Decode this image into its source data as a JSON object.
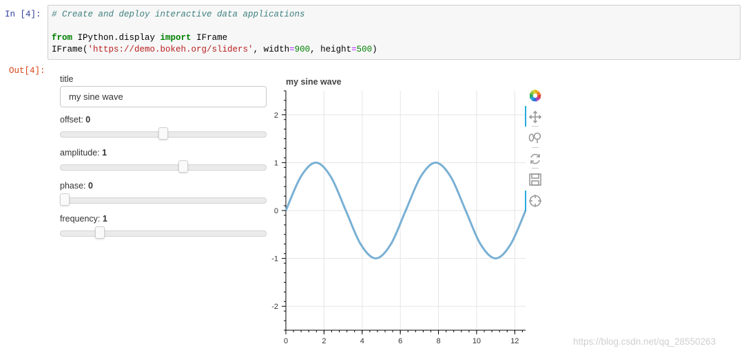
{
  "notebook": {
    "in_prompt": "In  [4]:",
    "out_prompt": "Out[4]:",
    "code": {
      "comment": "# Create and deploy interactive data applications",
      "kw_from": "from",
      "module": " IPython.display ",
      "kw_import": "import",
      "imported": " IFrame",
      "call_name": "IFrame(",
      "url_str": "'https://demo.bokeh.org/sliders'",
      "comma_width": ", width",
      "eq1": "=",
      "width_val": "900",
      "comma_height": ", height",
      "eq2": "=",
      "height_val": "500",
      "close_paren": ")"
    }
  },
  "widgets": {
    "title_label": "title",
    "title_value": "my sine wave",
    "sliders": [
      {
        "label": "offset: ",
        "value": "0",
        "min": -5,
        "max": 5,
        "current": 0
      },
      {
        "label": "amplitude: ",
        "value": "1",
        "min": -5,
        "max": 5,
        "current": 1
      },
      {
        "label": "phase: ",
        "value": "0",
        "min": 0,
        "max": 6.2832,
        "current": 0
      },
      {
        "label": "frequency: ",
        "value": "1",
        "min": 0.1,
        "max": 5.1,
        "current": 1
      }
    ]
  },
  "chart_data": {
    "type": "line",
    "title": "my sine wave",
    "xlabel": "",
    "ylabel": "",
    "xlim": [
      0,
      12.566
    ],
    "ylim": [
      -2.5,
      2.5
    ],
    "x_ticks": [
      0,
      2,
      4,
      6,
      8,
      10,
      12
    ],
    "y_ticks": [
      -2,
      -1,
      0,
      1,
      2
    ],
    "grid": true,
    "series": [
      {
        "color": "#7ab0d4",
        "x": [
          0,
          0.785,
          1.571,
          2.356,
          3.142,
          3.927,
          4.712,
          5.498,
          6.283,
          7.069,
          7.854,
          8.639,
          9.425,
          10.21,
          10.996,
          11.781,
          12.566
        ],
        "y": [
          0,
          0.707,
          1,
          0.707,
          0,
          -0.707,
          -1,
          -0.707,
          0,
          0.707,
          1,
          0.707,
          0,
          -0.707,
          -1,
          -0.707,
          0
        ]
      }
    ]
  },
  "toolbar": {
    "tools": [
      "bokeh-logo-icon",
      "pan-icon",
      "wheel-zoom-icon",
      "reset-icon",
      "save-icon",
      "crosshair-icon"
    ]
  },
  "watermark": "https://blog.csdn.net/qq_28550263"
}
